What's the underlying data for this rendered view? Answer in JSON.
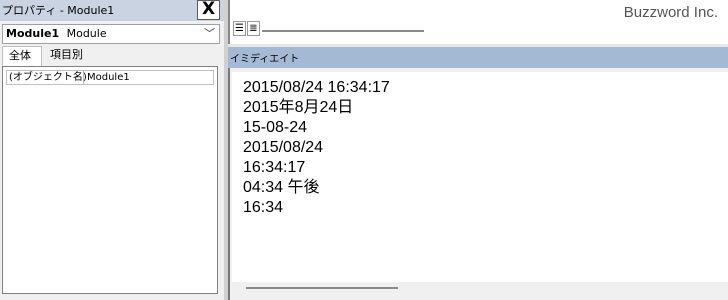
{
  "properties": {
    "title": "プロパティ - Module1",
    "close_label": "X",
    "object_select": {
      "name": "Module1",
      "type": "Module",
      "chevron": "﹀"
    },
    "tabs": [
      {
        "label": "全体"
      },
      {
        "label": "項目別"
      }
    ],
    "grid": {
      "rows": [
        {
          "name": "(オブジェクト名)",
          "value": "Module1"
        }
      ]
    }
  },
  "code_window": {
    "view_buttons": {
      "procedure_glyph": "☰",
      "full_module_glyph": "≣"
    }
  },
  "watermark": "Buzzword Inc.",
  "immediate": {
    "title": "イミディエイト",
    "lines": [
      "2015/08/24 16:34:17",
      "2015年8月24日",
      "15-08-24",
      "2015/08/24",
      "16:34:17",
      "04:34 午後",
      "16:34"
    ]
  }
}
